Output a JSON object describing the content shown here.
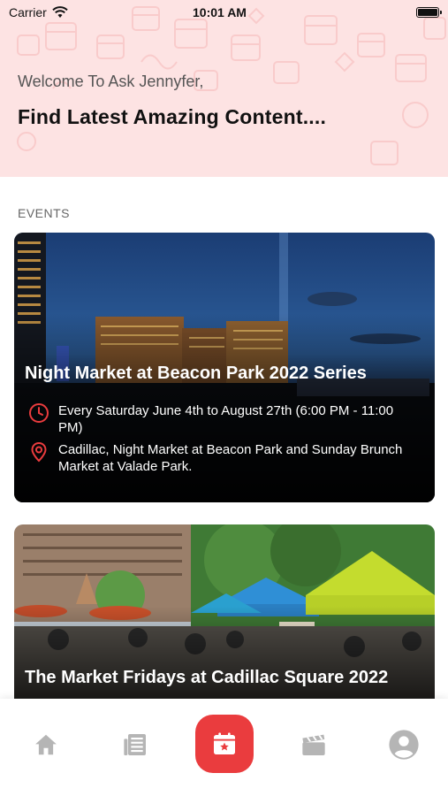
{
  "status_bar": {
    "carrier": "Carrier",
    "time": "10:01 AM"
  },
  "header": {
    "welcome": "Welcome To Ask Jennyfer,",
    "tagline": "Find Latest Amazing Content...."
  },
  "section": {
    "label": "EVENTS"
  },
  "events": [
    {
      "title": "Night Market at Beacon Park 2022 Series",
      "schedule": "Every Saturday June 4th to August 27th (6:00 PM - 11:00 PM)",
      "location": "Cadillac, Night Market at Beacon Park and Sunday Brunch Market at Valade Park."
    },
    {
      "title": "The Market Fridays at Cadillac Square 2022"
    }
  ],
  "tabbar": {
    "tabs": [
      {
        "icon": "home-icon",
        "active": false
      },
      {
        "icon": "news-icon",
        "active": false
      },
      {
        "icon": "calendar-icon",
        "active": true
      },
      {
        "icon": "clapperboard-icon",
        "active": false
      },
      {
        "icon": "profile-icon",
        "active": false
      }
    ]
  },
  "colors": {
    "accent": "#ea3c3e",
    "header_bg": "#fde3e3",
    "inactive_icon": "#b5b5b5"
  }
}
